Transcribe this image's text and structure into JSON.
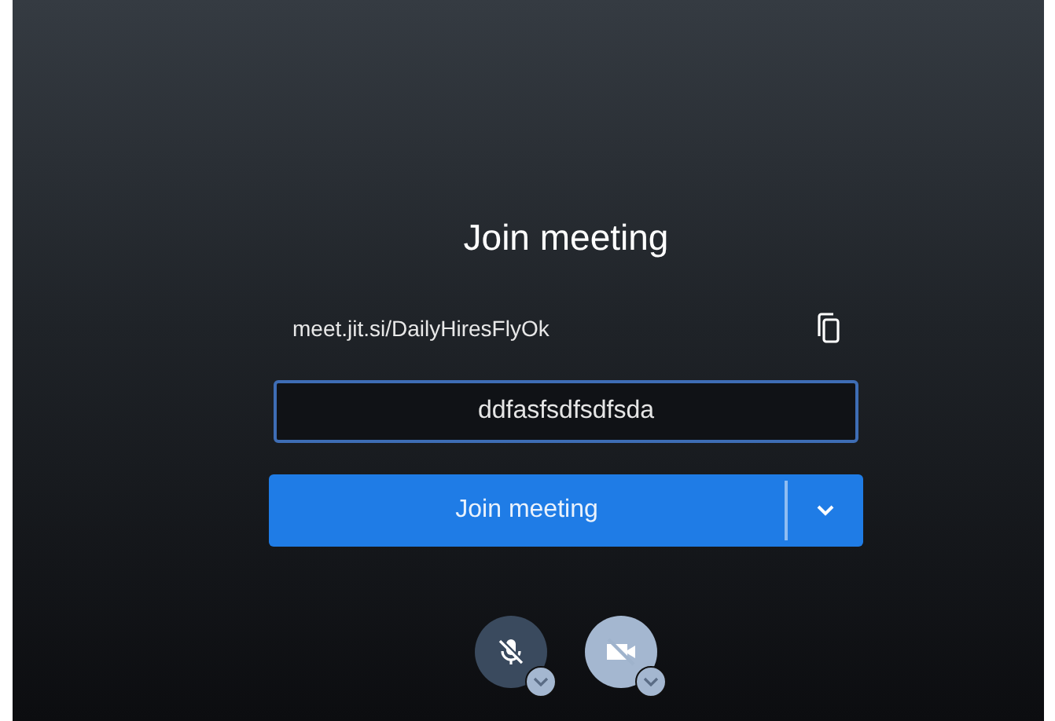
{
  "title": "Join meeting",
  "meeting_url": {
    "text": "meet.jit.si/DailyHiresFlyOk"
  },
  "name_field": {
    "value": "ddfasfsdfsdfsda",
    "focused": true
  },
  "join_button": {
    "label": "Join meeting"
  },
  "toggles": [
    {
      "kind": "microphone",
      "on": false
    },
    {
      "kind": "camera",
      "on": false
    }
  ]
}
